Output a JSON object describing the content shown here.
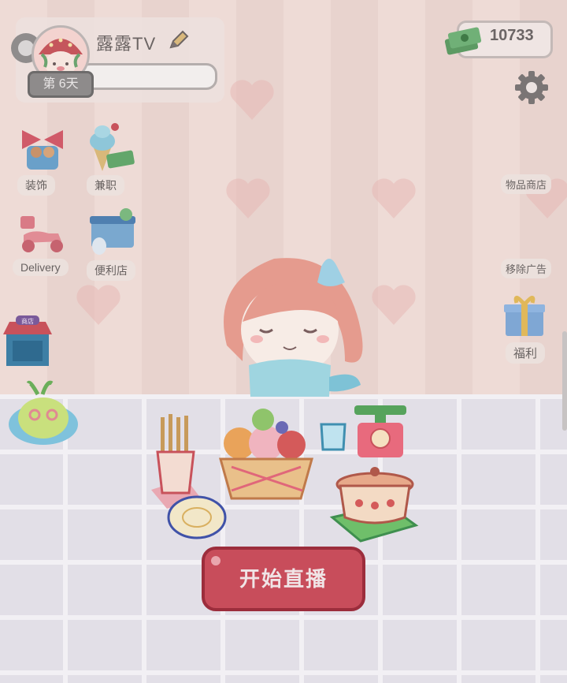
{
  "player": {
    "name": "露露TV",
    "day_label": "第 6天"
  },
  "currency": {
    "coins": "10733"
  },
  "left_menu": {
    "decor": "装饰",
    "parttime": "兼职",
    "delivery": "Delivery",
    "convenience": "便利店"
  },
  "right_menu": {
    "shop": "物品商店",
    "remove_ads": "移除广告",
    "welfare": "福利"
  },
  "icons": {
    "settings": "gear-icon",
    "edit": "pencil-icon",
    "cash": "cash-stack-icon",
    "store_sign": "商店"
  },
  "actions": {
    "start_live": "开始直播"
  },
  "colors": {
    "primary_button": "#c84d5b",
    "accent_green": "#3f8f4f"
  }
}
